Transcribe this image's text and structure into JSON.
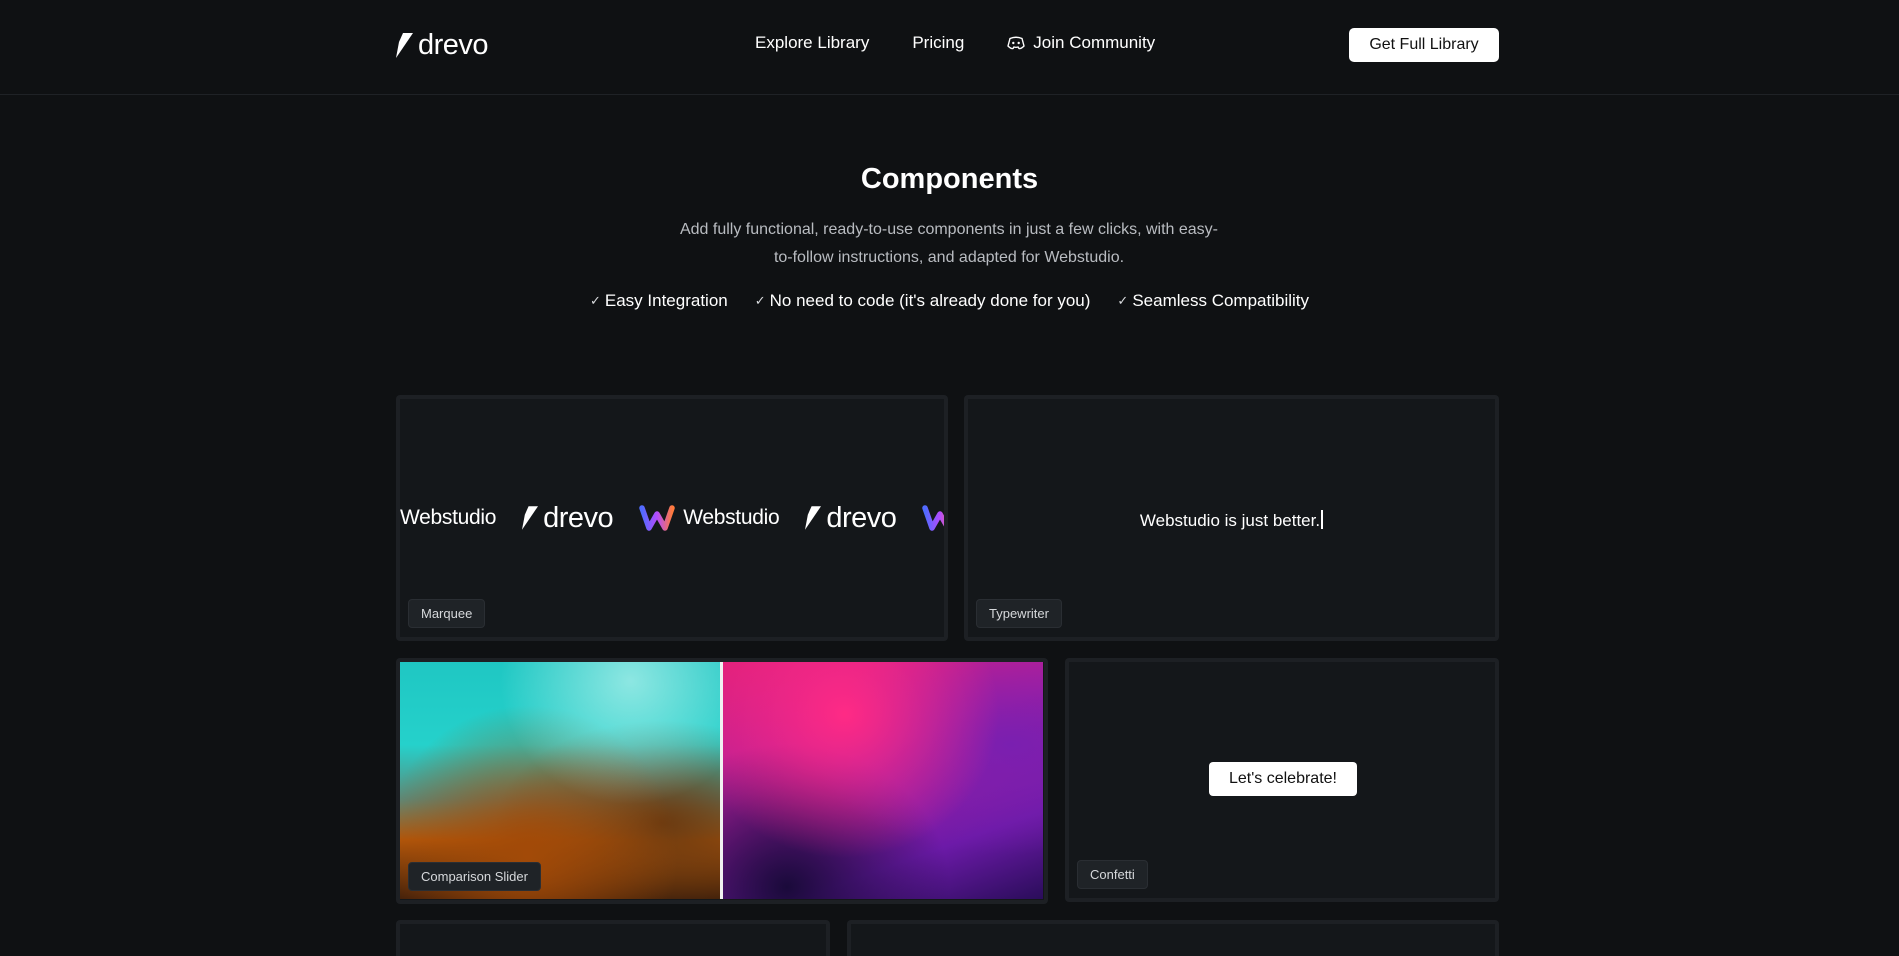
{
  "header": {
    "logo_text": "drevo",
    "nav": [
      {
        "label": "Explore Library"
      },
      {
        "label": "Pricing"
      },
      {
        "label": "Join Community",
        "icon": "discord-icon"
      }
    ],
    "cta_label": "Get Full Library"
  },
  "hero": {
    "title": "Components",
    "subtitle_line1": "Add fully functional, ready-to-use components in just a few clicks, with easy-",
    "subtitle_line2": "to-follow instructions, and adapted for Webstudio.",
    "features": [
      {
        "label": "Easy Integration",
        "icon": "check-icon"
      },
      {
        "label": "No need to code (it's already done for you)",
        "icon": "check-icon"
      },
      {
        "label": "Seamless Compatibility",
        "icon": "check-icon"
      }
    ]
  },
  "cards": {
    "marquee": {
      "label": "Marquee",
      "items": [
        "Webstudio",
        "drevo",
        "Webstudio",
        "drevo"
      ]
    },
    "typewriter": {
      "label": "Typewriter",
      "text": "Webstudio is just better."
    },
    "comparison": {
      "label": "Comparison Slider"
    },
    "confetti": {
      "label": "Confetti",
      "button_label": "Let's celebrate!"
    }
  },
  "colors": {
    "background": "#0f1113",
    "card": "#14171a",
    "card_border": "#1d2024",
    "text": "#ffffff",
    "muted": "#b9bcc1"
  }
}
